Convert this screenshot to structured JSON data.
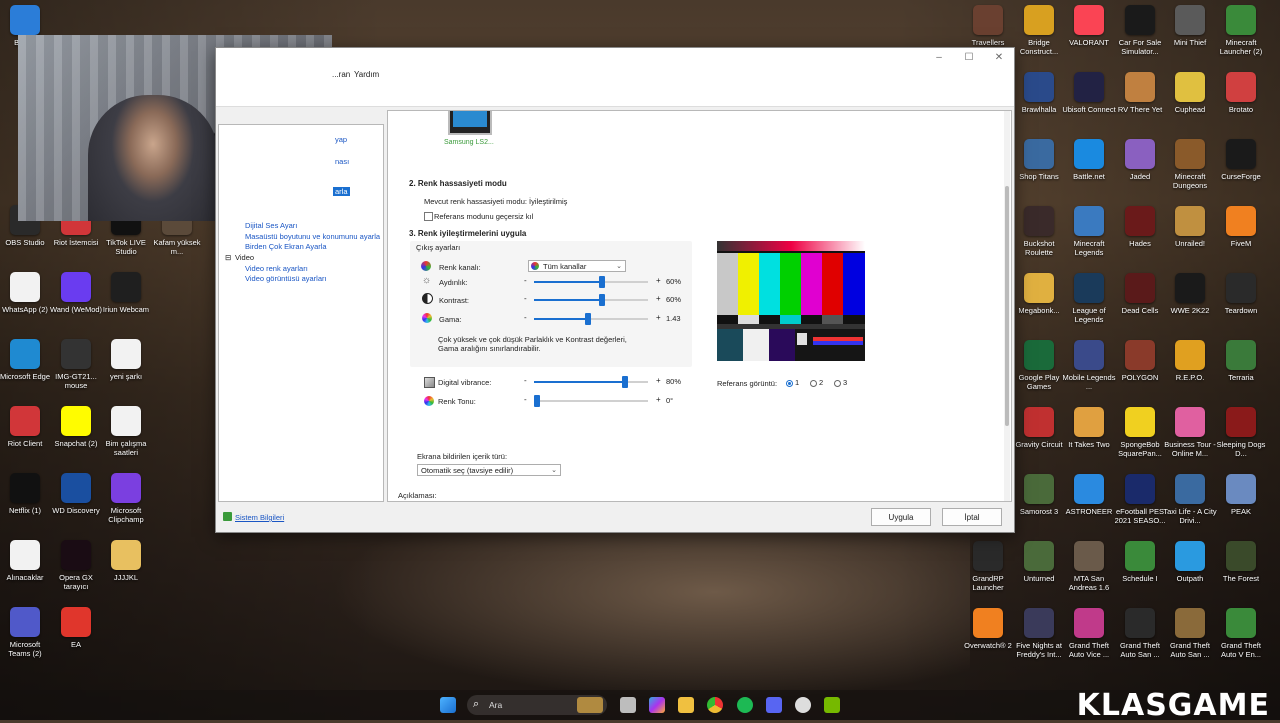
{
  "desktop_left": [
    {
      "label": "Bu b...",
      "color": "#2b7dd8"
    },
    {
      "label": "OBS Studio",
      "color": "#2a2a2a"
    },
    {
      "label": "Riot İstemcisi",
      "color": "#d13639"
    },
    {
      "label": "TikTok LIVE Studio",
      "color": "#111111"
    },
    {
      "label": "Kafam yüksek m...",
      "color": "#5b4a3a"
    },
    {
      "label": "WhatsApp (2)",
      "color": "#f2f2f2"
    },
    {
      "label": "Wand (WeMod)",
      "color": "#6a3cf0"
    },
    {
      "label": "Iriun Webcam",
      "color": "#1f1f1f"
    },
    {
      "label": "Microsoft Edge",
      "color": "#1f8ad1"
    },
    {
      "label": "IMG-GT21... mouse",
      "color": "#333333"
    },
    {
      "label": "yeni şarkı",
      "color": "#f2f2f2"
    },
    {
      "label": "Riot Client",
      "color": "#d13639"
    },
    {
      "label": "Snapchat (2)",
      "color": "#fffc00"
    },
    {
      "label": "Bim çalışma saatleri",
      "color": "#f2f2f2"
    },
    {
      "label": "Netflix (1)",
      "color": "#111111"
    },
    {
      "label": "WD Discovery",
      "color": "#1a4fa0"
    },
    {
      "label": "Microsoft Clipchamp",
      "color": "#7b3fe0"
    },
    {
      "label": "Alınacaklar",
      "color": "#f2f2f2"
    },
    {
      "label": "Opera GX tarayıcı",
      "color": "#1a0c14"
    },
    {
      "label": "JJJJKL",
      "color": "#e8c060"
    },
    {
      "label": "Microsoft Teams (2)",
      "color": "#5059c9"
    },
    {
      "label": "EA",
      "color": "#e0362c"
    }
  ],
  "desktop_right": [
    {
      "label": "Travellers",
      "color": "#6a4030"
    },
    {
      "label": "Bridge Construct...",
      "color": "#d8a020"
    },
    {
      "label": "VALORANT",
      "color": "#fa4454"
    },
    {
      "label": "Car For Sale Simulator...",
      "color": "#1a1a1a"
    },
    {
      "label": "Mini Thief",
      "color": "#5a5a5a"
    },
    {
      "label": "Minecraft Launcher (2)",
      "color": "#3a8a3a"
    },
    {
      "label": "Brawlhalla",
      "color": "#2a4a8a"
    },
    {
      "label": "Ubisoft Connect",
      "color": "#222244"
    },
    {
      "label": "RV There Yet",
      "color": "#c08040"
    },
    {
      "label": "Cuphead",
      "color": "#e0c040"
    },
    {
      "label": "Brotato",
      "color": "#d04040"
    },
    {
      "label": "Shop Titans",
      "color": "#3a6aa0"
    },
    {
      "label": "Battle.net",
      "color": "#1a8ae0"
    },
    {
      "label": "Jaded",
      "color": "#8a60c0"
    },
    {
      "label": "Minecraft Dungeons",
      "color": "#8a5a2a"
    },
    {
      "label": "CurseForge",
      "color": "#1a1a1a"
    },
    {
      "label": "Buckshot Roulette",
      "color": "#3a2a2a"
    },
    {
      "label": "Minecraft Legends",
      "color": "#3a7ac0"
    },
    {
      "label": "Hades",
      "color": "#6a1a1a"
    },
    {
      "label": "Unrailed!",
      "color": "#c09040"
    },
    {
      "label": "FiveM",
      "color": "#f08020"
    },
    {
      "label": "Megabonk...",
      "color": "#e0b040"
    },
    {
      "label": "League of Legends",
      "color": "#1a3a5a"
    },
    {
      "label": "Dead Cells",
      "color": "#5a1a1a"
    },
    {
      "label": "WWE 2K22",
      "color": "#1a1a1a"
    },
    {
      "label": "Teardown",
      "color": "#2a2a2a"
    },
    {
      "label": "Google Play Games",
      "color": "#1a6a3a"
    },
    {
      "label": "Mobile Legends ...",
      "color": "#3a4a8a"
    },
    {
      "label": "POLYGON",
      "color": "#8a3a2a"
    },
    {
      "label": "R.E.P.O.",
      "color": "#e0a020"
    },
    {
      "label": "Terraria",
      "color": "#3a7a3a"
    },
    {
      "label": "Gravity Circuit",
      "color": "#c03030"
    },
    {
      "label": "It Takes Two",
      "color": "#e0a040"
    },
    {
      "label": "SpongeBob SquarePan...",
      "color": "#f0d020"
    },
    {
      "label": "Business Tour - Online M...",
      "color": "#e060a0"
    },
    {
      "label": "Sleeping Dogs D...",
      "color": "#8a1a1a"
    },
    {
      "label": "Samorost 3",
      "color": "#4a6a3a"
    },
    {
      "label": "ASTRONEER",
      "color": "#2a8ae0"
    },
    {
      "label": "eFootball PES 2021 SEASO...",
      "color": "#1a2a6a"
    },
    {
      "label": "Taxi Life - A City Drivi...",
      "color": "#3a6aa0"
    },
    {
      "label": "PEAK",
      "color": "#6a8ac0"
    },
    {
      "label": "GrandRP Launcher",
      "color": "#2a2a2a"
    },
    {
      "label": "Unturned",
      "color": "#4a6a3a"
    },
    {
      "label": "MTA San Andreas 1.6",
      "color": "#6a5a4a"
    },
    {
      "label": "Schedule I",
      "color": "#3a8a3a"
    },
    {
      "label": "Outpath",
      "color": "#2a9ae0"
    },
    {
      "label": "The Forest",
      "color": "#3a4a2a"
    },
    {
      "label": "Overwatch® 2",
      "color": "#f08020"
    },
    {
      "label": "Five Nights at Freddy's Int...",
      "color": "#3a3a5a"
    },
    {
      "label": "Grand Theft Auto Vice ...",
      "color": "#c03a8a"
    },
    {
      "label": "Grand Theft Auto San ...",
      "color": "#2a2a2a"
    },
    {
      "label": "Grand Theft Auto San ...",
      "color": "#8a6a3a"
    },
    {
      "label": "Grand Theft Auto V En...",
      "color": "#3a8a3a"
    }
  ],
  "window": {
    "menu": [
      "...ran",
      "Yardım"
    ],
    "left_tree": [
      {
        "label": "yap",
        "link": true
      },
      {
        "label": "nası",
        "link": true
      },
      {
        "label": "arla",
        "link": true,
        "selected": true
      },
      {
        "label": "Dijital Ses Ayarı",
        "link": true
      },
      {
        "label": "Masaüstü boyutunu ve konumunu ayarla",
        "link": true
      },
      {
        "label": "Birden Çok Ekran Ayarla",
        "link": true
      },
      {
        "label": "Video",
        "link": false
      },
      {
        "label": "Video renk ayarları",
        "link": true
      },
      {
        "label": "Video görüntüsü ayarları",
        "link": true
      }
    ],
    "monitor_label": "Samsung LS2...",
    "section2_title": "2. Renk hassasiyeti modu",
    "current_mode": "Mevcut renk hassasiyeti modu: İyileştirilmiş",
    "ref_checkbox_label": "Referans modunu geçersiz kıl",
    "section3_title": "3. Renk iyileştirmelerini uygula",
    "output_settings_title": "Çıkış ayarları",
    "channel_label": "Renk kanalı:",
    "channel_value": "Tüm kanallar",
    "brightness_label": "Aydınlık:",
    "brightness_value": "60%",
    "brightness_level": 0.6,
    "contrast_label": "Kontrast:",
    "contrast_value": "60%",
    "contrast_level": 0.6,
    "gamma_label": "Gama:",
    "gamma_value": "1.43",
    "gamma_level": 0.47,
    "note": "Çok yüksek ve çok düşük Parlaklık ve Kontrast değerleri, Gama aralığını sınırlandırabilir.",
    "vibrance_label": "Digital vibrance:",
    "vibrance_value": "80%",
    "vibrance_level": 0.8,
    "hue_label": "Renk Tonu:",
    "hue_value": "0°",
    "hue_level": 0.0,
    "minus": "-",
    "plus": "+",
    "reference_label": "Referans görüntü:",
    "reference_options": [
      "1",
      "2",
      "3"
    ],
    "reference_selected": "1",
    "content_type_label": "Ekrana bildirilen içerik türü:",
    "content_type_value": "Otomatik seç (tavsiye edilir)",
    "description_label": "Açıklaması:",
    "system_info": "Sistem Bilgileri",
    "apply_button": "Uygula",
    "cancel_button": "İptal"
  },
  "taskbar": {
    "search_placeholder": "Ara",
    "watermark": "KLASGAME"
  }
}
